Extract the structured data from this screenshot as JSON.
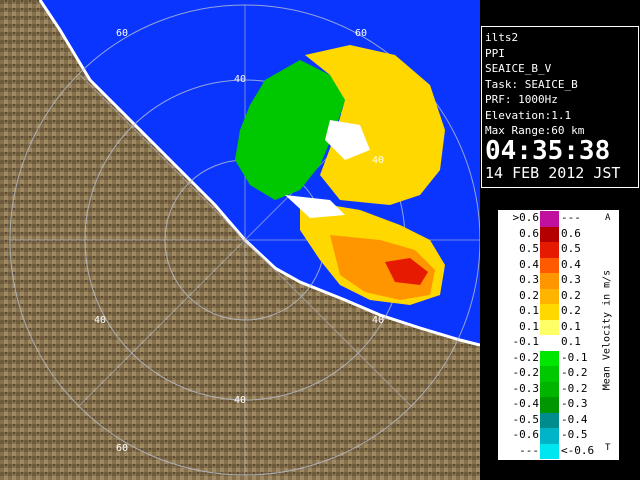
{
  "info_panel": {
    "station": "ilts2",
    "mode": "PPI",
    "scan": "SEAICE_B_V",
    "task": "Task: SEAICE_B",
    "prf": "PRF: 1000Hz",
    "elevation": "Elevation:1.1",
    "max_range": "Max Range:60 km",
    "time": "04:35:38",
    "date": "14 FEB 2012 JST"
  },
  "range_ring_labels": [
    "60",
    "60",
    "40",
    "40",
    "40",
    "40",
    "40",
    "60"
  ],
  "legend": {
    "title": "Mean Velocity in m/s",
    "corner_top": "A",
    "corner_bottom": "T",
    "rows": [
      {
        "left": ">0.6",
        "right": "---",
        "color": "#c0109e"
      },
      {
        "left": "0.6",
        "right": "0.6",
        "color": "#b40000"
      },
      {
        "left": "0.5",
        "right": "0.5",
        "color": "#e61a00"
      },
      {
        "left": "0.4",
        "right": "0.4",
        "color": "#ff5a00"
      },
      {
        "left": "0.3",
        "right": "0.3",
        "color": "#ff9600"
      },
      {
        "left": "0.2",
        "right": "0.2",
        "color": "#ffb400"
      },
      {
        "left": "0.1",
        "right": "0.2",
        "color": "#ffd800"
      },
      {
        "left": "0.1",
        "right": "0.1",
        "color": "#ffff66"
      },
      {
        "left": "-0.1",
        "right": "0.1",
        "color": "#ffffff"
      },
      {
        "left": "-0.2",
        "right": "-0.1",
        "color": "#00e600"
      },
      {
        "left": "-0.2",
        "right": "-0.2",
        "color": "#00c800"
      },
      {
        "left": "-0.3",
        "right": "-0.2",
        "color": "#00b400"
      },
      {
        "left": "-0.4",
        "right": "-0.3",
        "color": "#009600"
      },
      {
        "left": "-0.5",
        "right": "-0.4",
        "color": "#008c8c"
      },
      {
        "left": "-0.6",
        "right": "-0.5",
        "color": "#00b4c8"
      },
      {
        "left": "---",
        "right": "<-0.6",
        "color": "#00e6f0"
      }
    ]
  },
  "colors": {
    "sea": "#0a35ff",
    "land": "#86714f",
    "coast": "#ffffff"
  }
}
